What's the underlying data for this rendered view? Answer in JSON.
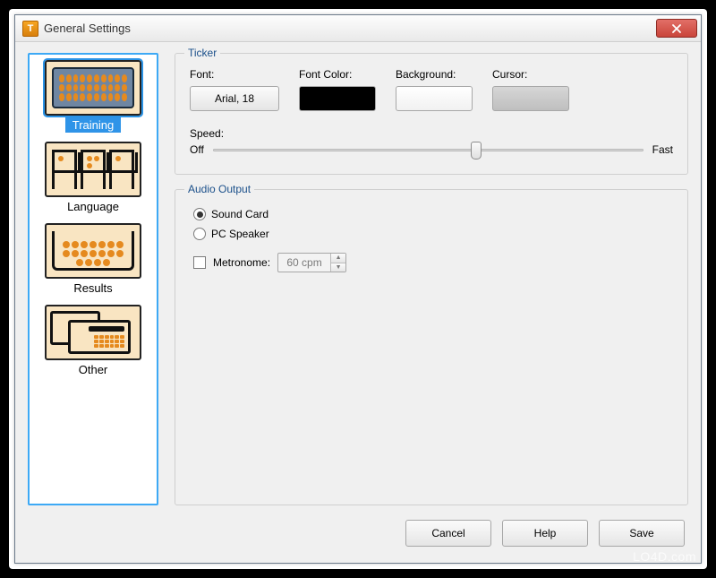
{
  "window": {
    "title": "General Settings"
  },
  "sidebar": {
    "items": [
      {
        "label": "Training",
        "selected": true
      },
      {
        "label": "Language",
        "selected": false
      },
      {
        "label": "Results",
        "selected": false
      },
      {
        "label": "Other",
        "selected": false
      }
    ]
  },
  "ticker": {
    "legend": "Ticker",
    "font_label": "Font:",
    "font_button": "Arial, 18",
    "fontcolor_label": "Font Color:",
    "fontcolor_value": "#000000",
    "background_label": "Background:",
    "background_value": "#ffffff",
    "cursor_label": "Cursor:",
    "cursor_value": "#c4c4c4",
    "speed_label": "Speed:",
    "speed_min_label": "Off",
    "speed_max_label": "Fast",
    "speed_value": 60
  },
  "audio": {
    "legend": "Audio Output",
    "options": [
      {
        "label": "Sound Card",
        "checked": true
      },
      {
        "label": "PC Speaker",
        "checked": false
      }
    ],
    "metronome_label": "Metronome:",
    "metronome_checked": false,
    "metronome_value": "60 cpm"
  },
  "footer": {
    "cancel": "Cancel",
    "help": "Help",
    "save": "Save"
  },
  "watermark": "LO4D.com"
}
